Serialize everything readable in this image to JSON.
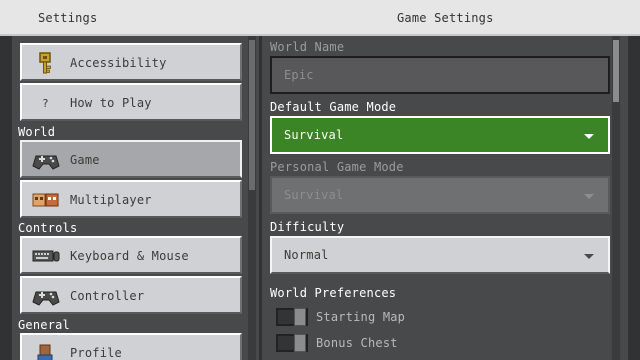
{
  "topbar": {
    "left_title": "Settings",
    "right_title": "Game Settings"
  },
  "sidebar": {
    "items": [
      {
        "label": "Accessibility",
        "icon": "key-icon"
      },
      {
        "label": "How to Play",
        "icon": "question-icon"
      },
      {
        "label": "Game",
        "icon": "controller-icon",
        "selected": true
      },
      {
        "label": "Multiplayer",
        "icon": "multiplayer-icon"
      },
      {
        "label": "Keyboard & Mouse",
        "icon": "keyboard-icon"
      },
      {
        "label": "Controller",
        "icon": "controller-icon"
      },
      {
        "label": "Profile",
        "icon": "profile-icon"
      }
    ],
    "sections": {
      "world": "World",
      "controls": "Controls",
      "general": "General"
    }
  },
  "game_settings": {
    "world_name_label": "World Name",
    "world_name_placeholder": "Epic",
    "default_mode_label": "Default Game Mode",
    "default_mode_value": "Survival",
    "personal_mode_label": "Personal Game Mode",
    "personal_mode_value": "Survival",
    "difficulty_label": "Difficulty",
    "difficulty_value": "Normal",
    "world_prefs_label": "World Preferences",
    "starting_map_label": "Starting Map",
    "bonus_chest_label": "Bonus Chest"
  },
  "colors": {
    "accent_green": "#3c8527",
    "panel": "#48494a",
    "button": "#d0d1d4"
  }
}
